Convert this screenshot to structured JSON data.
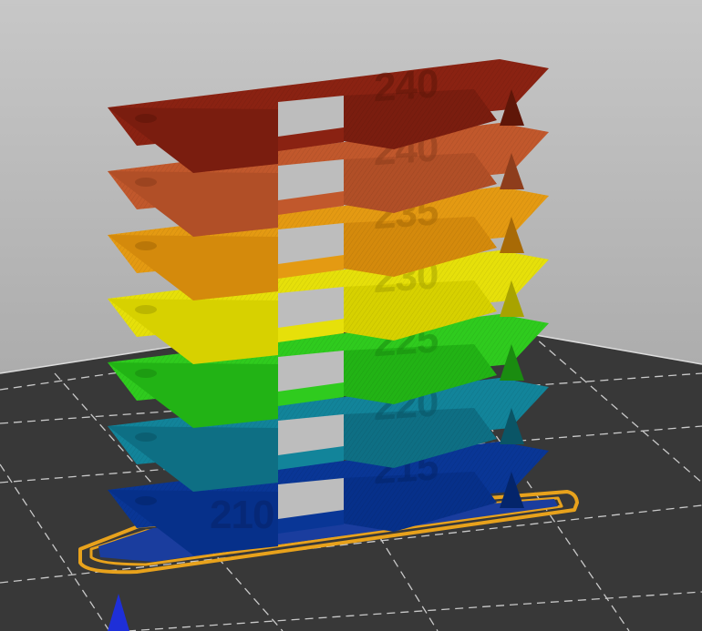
{
  "scene": {
    "object": "temperature tower",
    "colors": {
      "background_top": "#c7c7c7",
      "background_bottom": "#9a9a9a",
      "bed": "#383838",
      "grid_line": "#c9c9c9",
      "skirt": "#e8a21c",
      "first_layer": "#1a3d9e",
      "axis_marker": "#1e2fd8"
    }
  },
  "tower": {
    "blocks": [
      {
        "label": "240",
        "top": "#8a2212",
        "front": "#7a1d0f",
        "side": "#5f1608"
      },
      {
        "label": "240",
        "top": "#c1582c",
        "front": "#b14f27",
        "side": "#8e3d1c"
      },
      {
        "label": "235",
        "top": "#e49a12",
        "front": "#d48a0c",
        "side": "#a86a06"
      },
      {
        "label": "230",
        "top": "#e6e00a",
        "front": "#d7d100",
        "side": "#a8a300"
      },
      {
        "label": "225",
        "top": "#2fcb1e",
        "front": "#22b315",
        "side": "#1a8c10"
      },
      {
        "label": "220",
        "top": "#12849a",
        "front": "#0e6f84",
        "side": "#0a5566"
      },
      {
        "label": "215",
        "top": "#093696",
        "front": "#06308a",
        "side": "#04256b"
      }
    ],
    "base_label": "210"
  }
}
